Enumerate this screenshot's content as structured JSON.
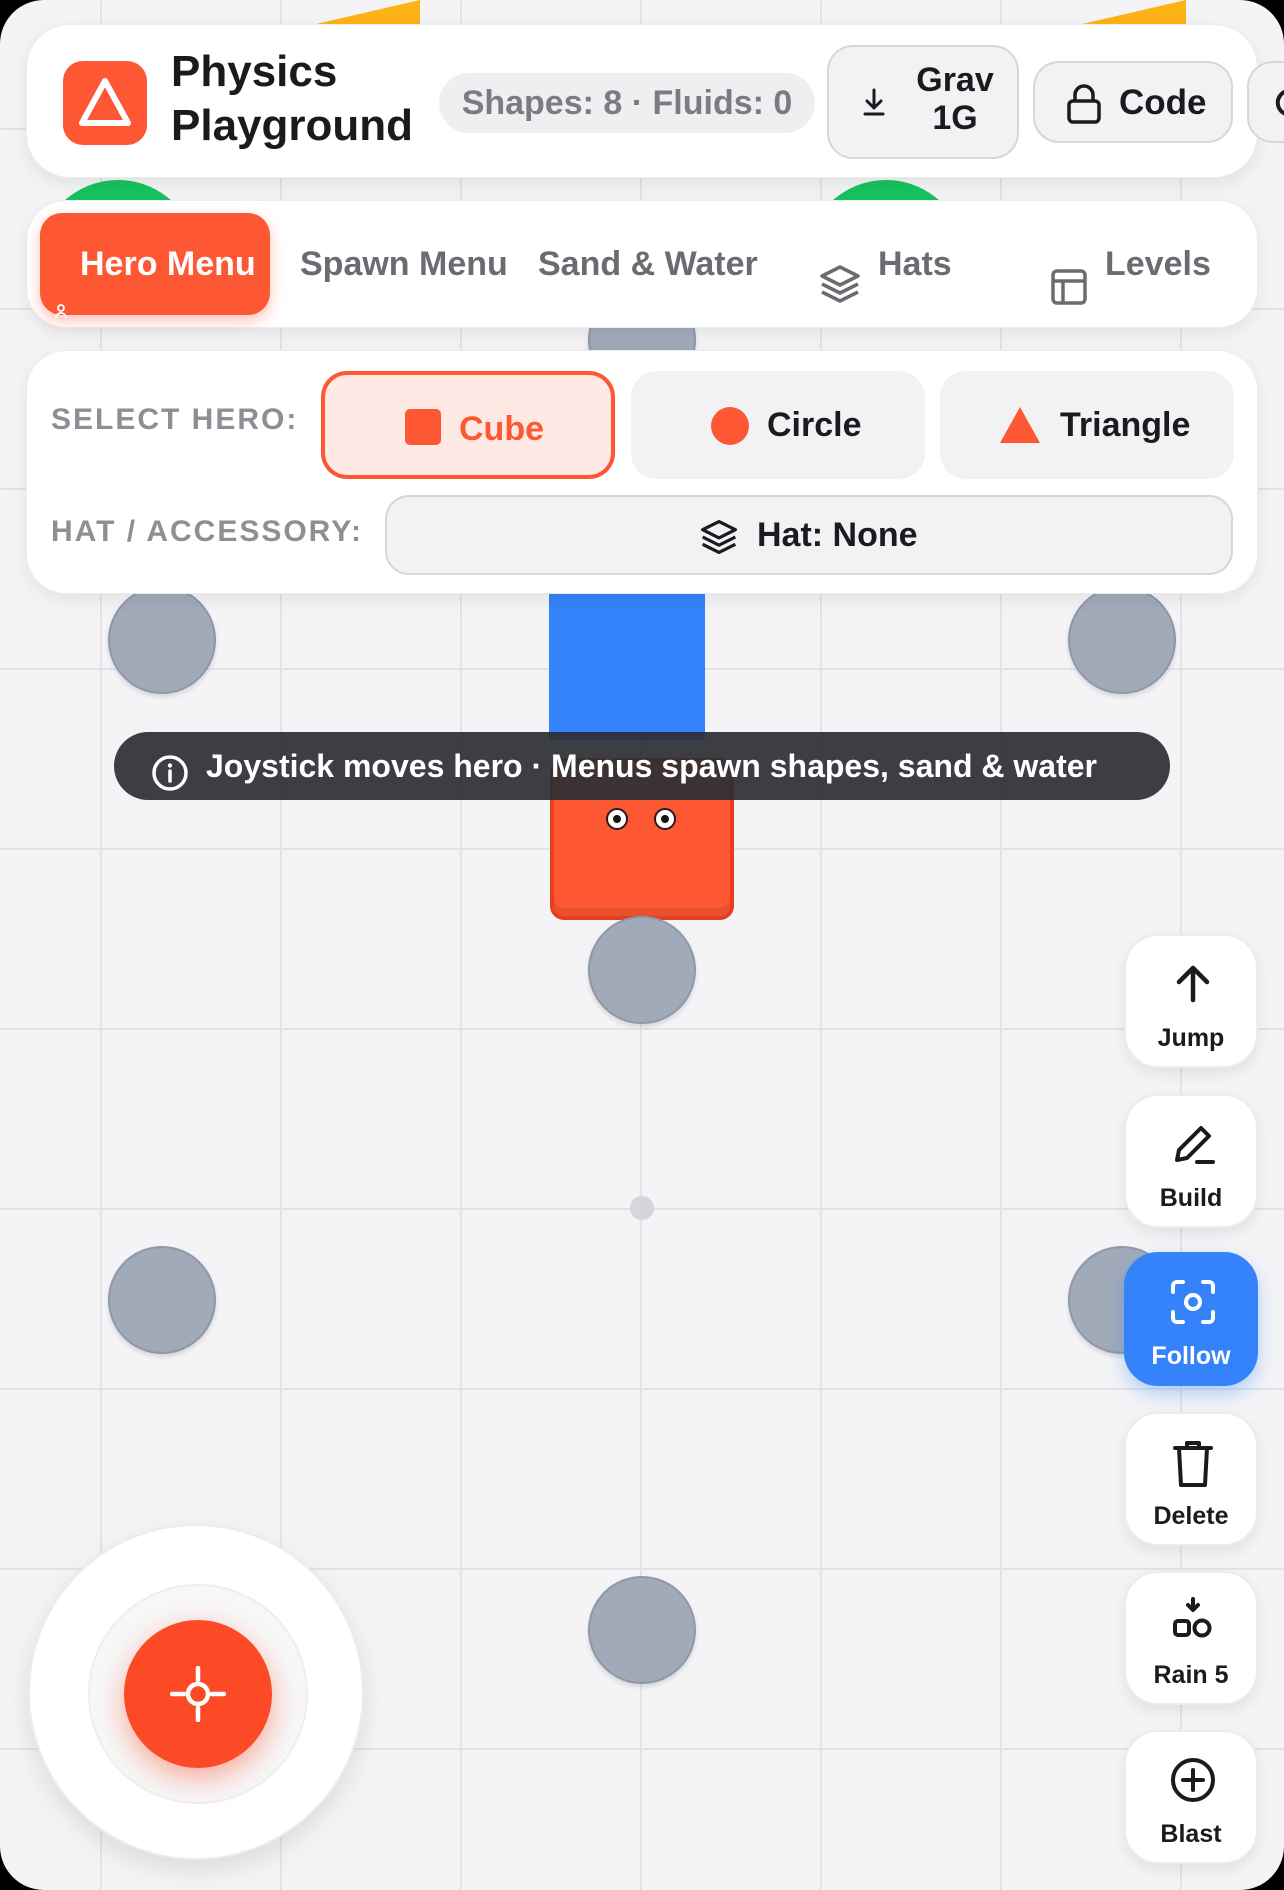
{
  "app": {
    "title": "Physics Playground",
    "stats": "Shapes: 8 · Fluids: 0",
    "logo_icon": "triangle-outline-icon",
    "accent_color": "#fd5733"
  },
  "header": {
    "gravity_label": "Grav 1G",
    "gravity_icon": "download-arrow-icon",
    "code_label": "Code",
    "code_icon": "lock-icon",
    "reset_icon": "reset-icon"
  },
  "tabs": [
    {
      "label": "Hero Menu",
      "icon": "person-icon",
      "active": true
    },
    {
      "label": "Spawn Menu",
      "active": false
    },
    {
      "label": "Sand & Water",
      "active": false
    },
    {
      "label": "Hats",
      "icon": "layers-icon",
      "active": false
    },
    {
      "label": "Levels",
      "icon": "layout-icon",
      "active": false
    }
  ],
  "hero_panel": {
    "select_label": "SELECT HERO:",
    "hat_label": "HAT / ACCESSORY:",
    "options": [
      {
        "label": "Cube",
        "selected": true
      },
      {
        "label": "Circle",
        "selected": false
      },
      {
        "label": "Triangle",
        "selected": false
      }
    ],
    "hat_value": "Hat: None"
  },
  "hint": {
    "text": "Joystick moves hero · Menus spawn shapes, sand & water",
    "icon": "info-icon"
  },
  "actions": [
    {
      "label": "Jump",
      "icon": "arrow-up-icon",
      "active": false
    },
    {
      "label": "Build",
      "icon": "pencil-icon",
      "active": false
    },
    {
      "label": "Follow",
      "icon": "focus-icon",
      "active": true,
      "color": "#3483fa"
    },
    {
      "label": "Delete",
      "icon": "trash-icon",
      "active": false
    },
    {
      "label": "Rain 5",
      "icon": "shapes-drop-icon",
      "active": false
    },
    {
      "label": "Blast",
      "icon": "plus-circle-icon",
      "active": false
    }
  ],
  "joystick": {
    "knob_icon": "crosshair-icon"
  }
}
